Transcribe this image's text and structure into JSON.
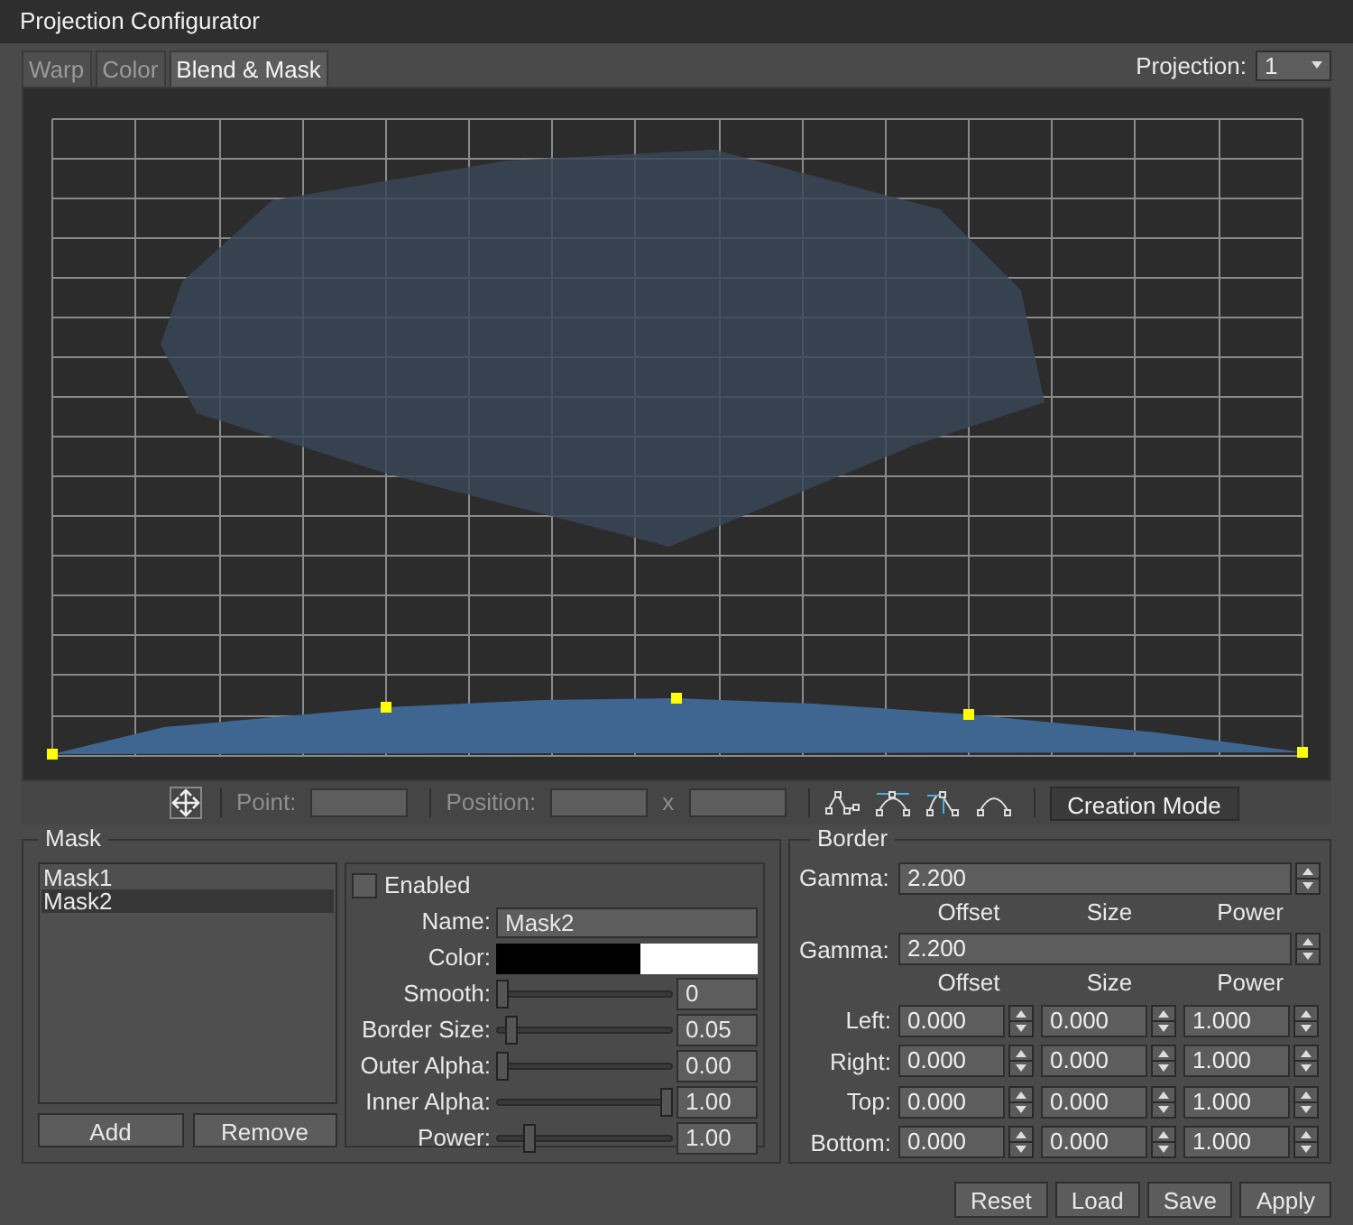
{
  "window": {
    "title": "Projection Configurator"
  },
  "tabs": [
    {
      "label": "Warp",
      "selected": false
    },
    {
      "label": "Color",
      "selected": false
    },
    {
      "label": "Blend & Mask",
      "selected": true
    }
  ],
  "projection": {
    "label": "Projection:",
    "value": "1"
  },
  "toolbar": {
    "point_label": "Point:",
    "position_label": "Position:",
    "separator": "x",
    "disabled": true,
    "mode_button": "Creation Mode"
  },
  "mask": {
    "title": "Mask",
    "items": [
      {
        "label": "Mask1",
        "selected": false
      },
      {
        "label": "Mask2",
        "selected": true
      }
    ],
    "add": "Add",
    "remove": "Remove",
    "enabled": {
      "label": "Enabled",
      "checked": false
    },
    "name": {
      "label": "Name:",
      "value": "Mask2"
    },
    "color_label": "Color:",
    "sliders": [
      {
        "label": "Smooth:",
        "level": 0,
        "value": "0"
      },
      {
        "label": "Border Size:",
        "level": 0.05,
        "value": "0.05"
      },
      {
        "label": "Outer Alpha:",
        "level": 0,
        "value": "0.00"
      },
      {
        "label": "Inner Alpha:",
        "level": 1,
        "value": "1.00"
      },
      {
        "label": "Power:",
        "level": 0.17,
        "value": "1.00"
      }
    ]
  },
  "border": {
    "title": "Border",
    "gammas": [
      {
        "label": "Gamma:",
        "value": "2.200",
        "columns": [
          "Offset",
          "Size",
          "Power"
        ]
      },
      {
        "label": "Gamma:",
        "value": "2.200",
        "columns": [
          "Offset",
          "Size",
          "Power"
        ]
      }
    ],
    "rows": [
      {
        "label": "Left:",
        "values": [
          "0.000",
          "0.000",
          "1.000"
        ]
      },
      {
        "label": "Right:",
        "values": [
          "0.000",
          "0.000",
          "1.000"
        ]
      },
      {
        "label": "Top:",
        "values": [
          "0.000",
          "0.000",
          "1.000"
        ]
      },
      {
        "label": "Bottom:",
        "values": [
          "0.000",
          "0.000",
          "1.000"
        ]
      }
    ]
  },
  "buttons": [
    "Reset",
    "Load",
    "Save",
    "Apply"
  ]
}
